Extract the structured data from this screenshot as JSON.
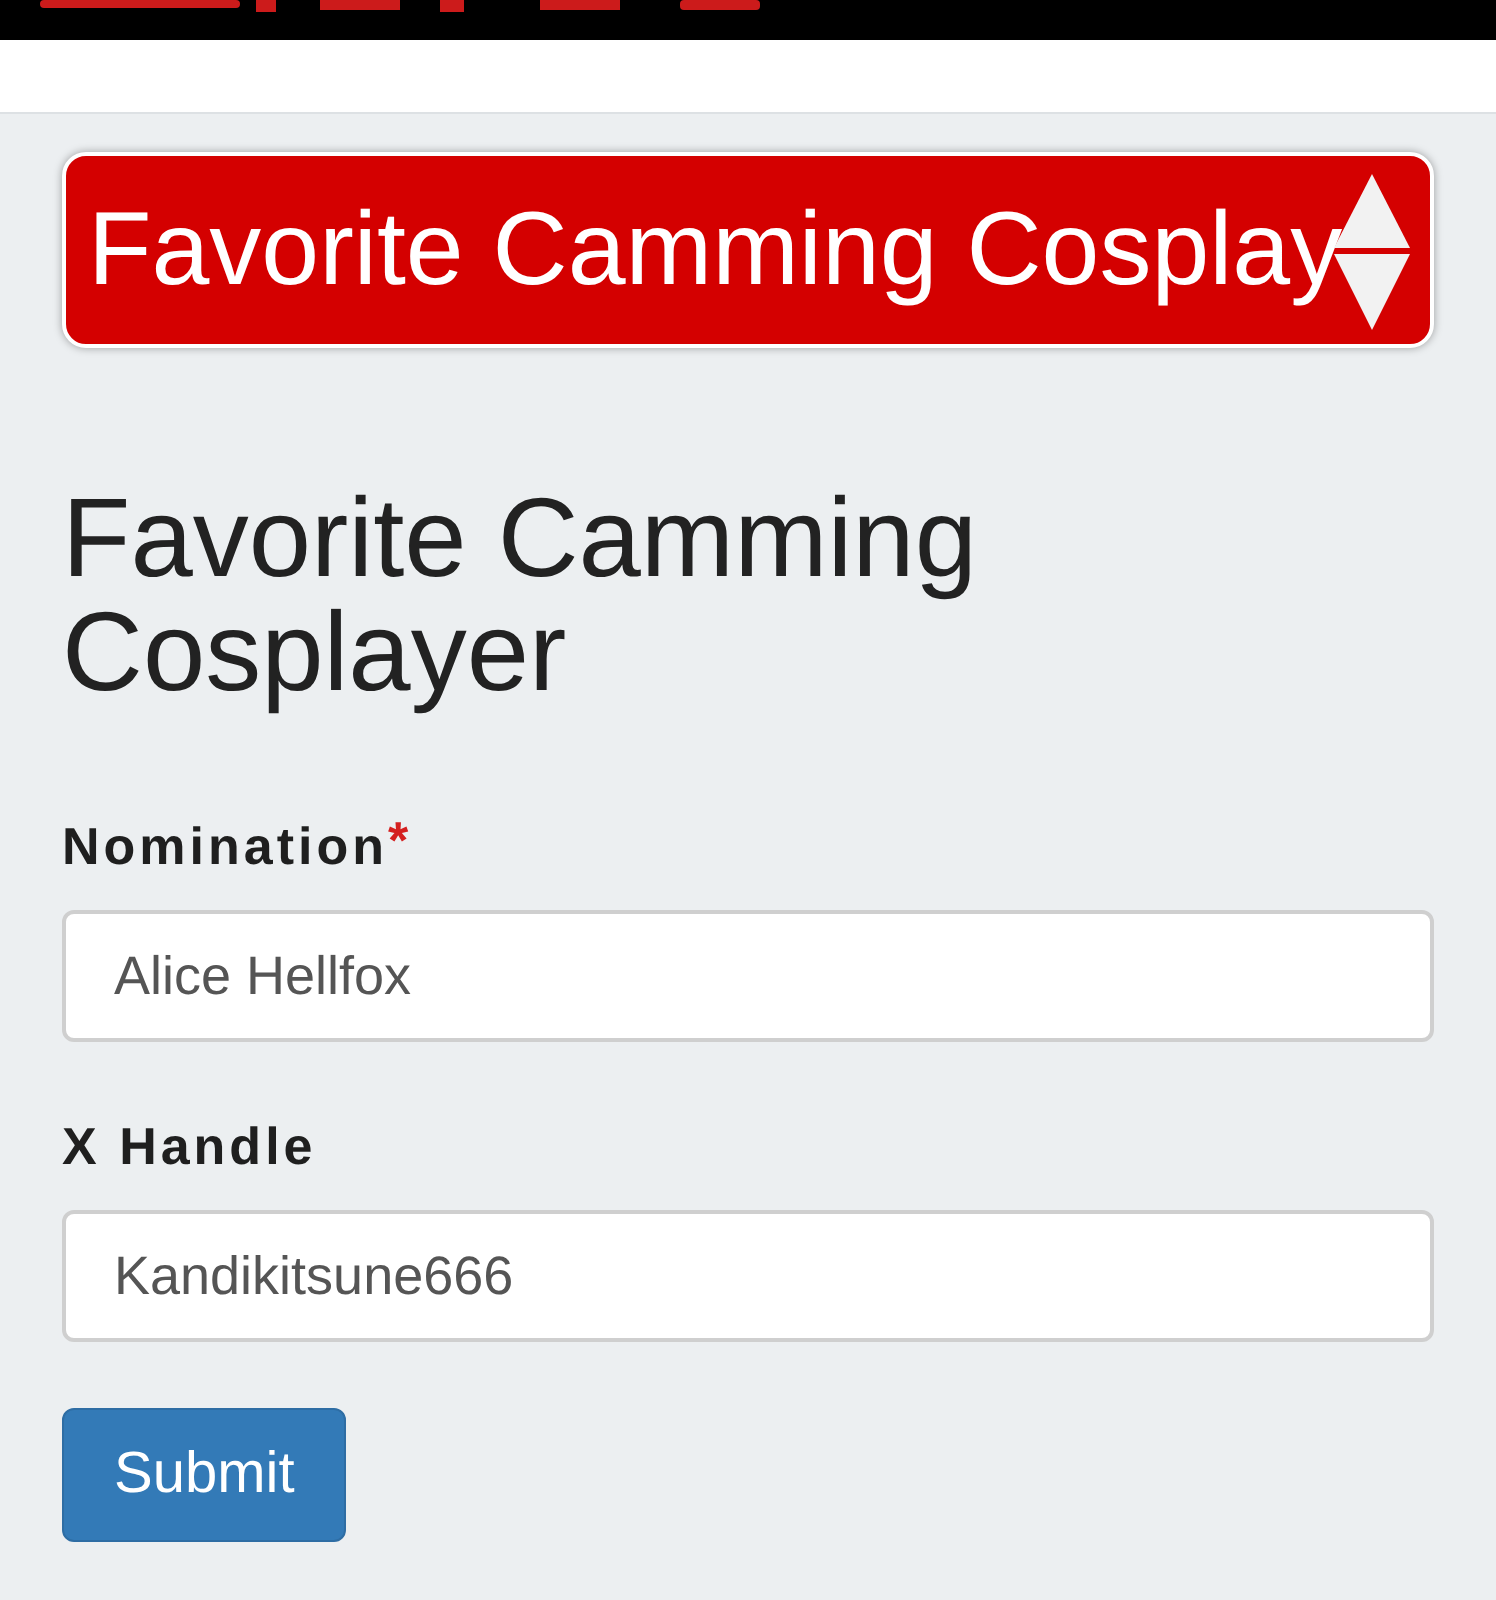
{
  "category_select": {
    "value": "Favorite Camming Cosplay"
  },
  "heading": "Favorite Camming Cosplayer",
  "fields": [
    {
      "label": "Nomination",
      "required_mark": "*",
      "value": "Alice Hellfox"
    },
    {
      "label": "X Handle",
      "value": "Kandikitsune666"
    }
  ],
  "buttons": [
    "Submit"
  ]
}
